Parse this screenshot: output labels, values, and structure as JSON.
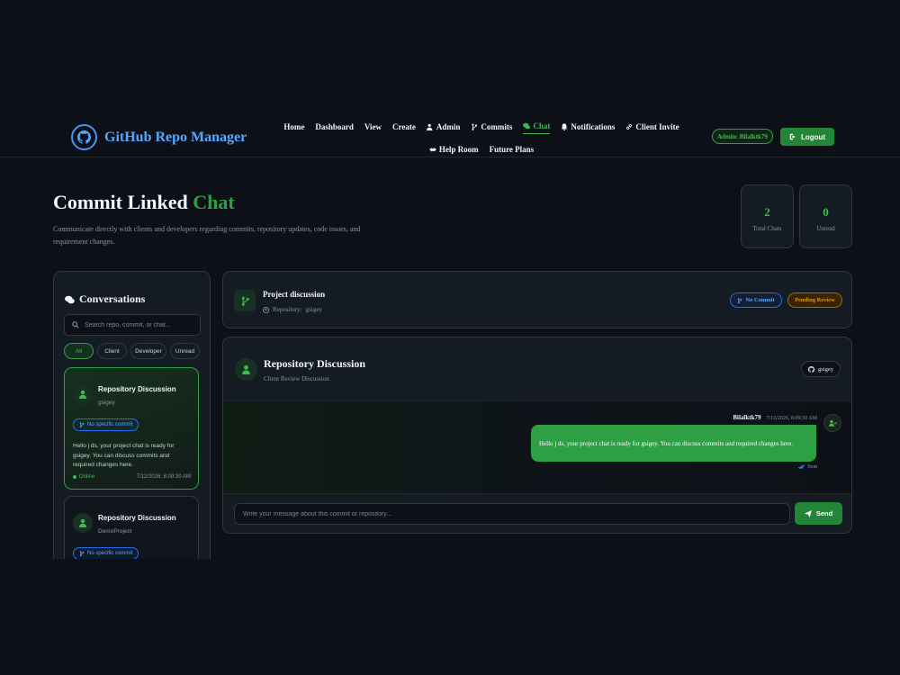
{
  "header": {
    "brand_title": "GitHub Repo Manager",
    "nav": [
      {
        "label": "Home",
        "icon": ""
      },
      {
        "label": "Dashboard",
        "icon": ""
      },
      {
        "label": "View",
        "icon": ""
      },
      {
        "label": "Create",
        "icon": ""
      },
      {
        "label": "Admin",
        "icon": "user-shield-icon"
      },
      {
        "label": "Commits",
        "icon": "code-branch-icon"
      },
      {
        "label": "Chat",
        "icon": "comments-icon",
        "active": true
      },
      {
        "label": "Notifications",
        "icon": "bell-icon"
      },
      {
        "label": "Client Invite",
        "icon": "link-icon"
      },
      {
        "label": "Help Room",
        "icon": "handshake-icon"
      },
      {
        "label": "Future Plans",
        "icon": ""
      }
    ],
    "admin_badge": "Admin: Bilalktk79",
    "logout_label": "Logout"
  },
  "page": {
    "title_main": "Commit Linked",
    "title_accent": "Chat",
    "description": "Communicate directly with clients and developers regarding commits, repository updates, code issues, and requirement changes."
  },
  "stats": [
    {
      "value": "2",
      "label": "Total Chats"
    },
    {
      "value": "0",
      "label": "Unread"
    }
  ],
  "conversations": {
    "heading": "Conversations",
    "search_placeholder": "Search repo, commit, or chat...",
    "filters": [
      "All",
      "Client",
      "Developer",
      "Unread"
    ],
    "active_filter": "All",
    "items": [
      {
        "title": "Repository Discussion",
        "repo": "gsigey",
        "tag": "No specific commit",
        "preview": "Hello j ds, your project chat is ready for gsigey. You can discuss commits and required changes here.",
        "status": "Online",
        "time": "7/12/2026, 8:09:30 AM",
        "active": true
      },
      {
        "title": "Repository Discussion",
        "repo": "DemoProject",
        "tag": "No specific commit"
      }
    ]
  },
  "topic": {
    "title": "Project discussion",
    "repo_label": "Repository:",
    "repo_name": "gsigey",
    "commit_pill": "No Commit",
    "review_pill": "Pending Review"
  },
  "chat": {
    "title": "Repository Discussion",
    "subtitle": "Client Review Discussion",
    "repo_chip": "gsigey",
    "messages": [
      {
        "author": "Bilalktk79",
        "time": "7/12/2026, 8:09:30 AM",
        "text": "Hello j ds, your project chat is ready for gsigey. You can discuss commits and required changes here.",
        "status": "Sent"
      }
    ],
    "composer_placeholder": "Write your message about this commit or repository...",
    "send_label": "Send"
  },
  "colors": {
    "background": "#0d1117",
    "panel": "#151b23",
    "accent_green": "#2ea043",
    "brand_blue": "#58a6ff",
    "amber": "#d29922"
  }
}
